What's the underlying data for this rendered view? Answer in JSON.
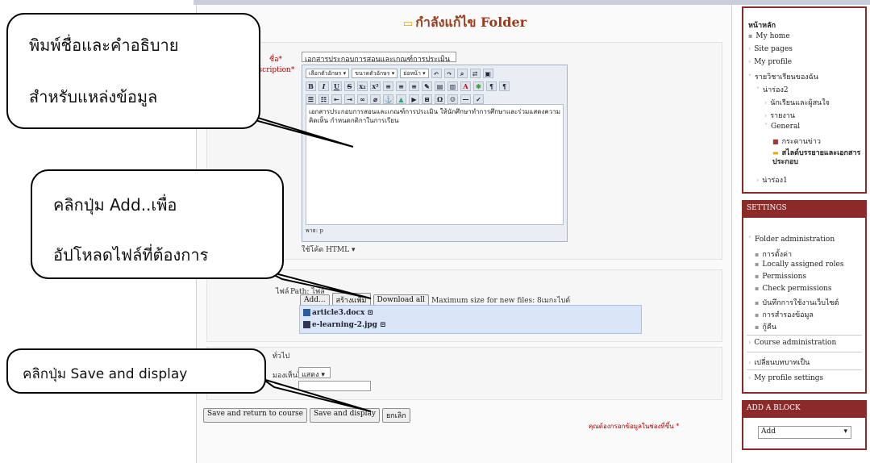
{
  "page": {
    "heading": "กำลังแก้ไข Folder"
  },
  "form": {
    "name_label": "ชื่อ",
    "name_value": "เอกสารประกอบการสอนและเกณฑ์การประเมิน",
    "description_label": "Description",
    "required_mark": "*",
    "editor": {
      "font_select": "เลือกตัวอักษร",
      "size_select": "ขนาดตัวอักษร",
      "style_select": "ย่อหน้า",
      "content": "เอกสารประกอบการสอนและเกณฑ์การประเมิน ให้นักศึกษาทำการศึกษาและร่วมแสดงความคิดเห็น กำหนดกติกาในการเรียน",
      "path": "พาธ: p",
      "format_select": "ใช้โค้ด HTML"
    },
    "files_label": "ไฟล์",
    "path_label": "Path:",
    "path_value": "ไฟล์",
    "add_button": "Add...",
    "create_folder_button": "สร้างแฟ้ม",
    "download_all_button": "Download all",
    "max_size": "Maximum size for new files: 8เมกะไบต์",
    "files": [
      {
        "name": "article3.docx"
      },
      {
        "name": "e-learning-2.jpg"
      }
    ],
    "section_header": "ทั่วไป",
    "visible_label": "มองเห็นได้",
    "visible_value": "แสดง",
    "save_return_button": "Save and return to course",
    "save_display_button": "Save and display",
    "cancel_button": "ยกเลิก",
    "required_note": "คุณต้องกรอกข้อมูลในช่องที่ขึ้น *"
  },
  "sidebar": {
    "navigation": {
      "title": "หน้าหลัก",
      "items": [
        {
          "label": "My home"
        },
        {
          "label": "Site pages"
        },
        {
          "label": "My profile"
        },
        {
          "label": "รายวิชาเรียนของฉัน"
        },
        {
          "label": "น่าร่อง2"
        },
        {
          "label": "นักเรียนและผู้สนใจ"
        },
        {
          "label": "รายงาน"
        },
        {
          "label": "General"
        },
        {
          "label": "กระดานข่าว"
        },
        {
          "label": "สไลด์บรรยายและเอกสารประกอบ"
        },
        {
          "label": "น่าร่อง1"
        }
      ]
    },
    "settings": {
      "title": "SETTINGS",
      "folder_admin": "Folder administration",
      "items": [
        {
          "label": "การตั้งค่า"
        },
        {
          "label": "Locally assigned roles"
        },
        {
          "label": "Permissions"
        },
        {
          "label": "Check permissions"
        },
        {
          "label": "บันทึกการใช้งานเว็บไซต์"
        },
        {
          "label": "การสำรองข้อมูล"
        },
        {
          "label": "กู้คืน"
        }
      ],
      "course_admin": "Course administration",
      "switch_role": "เปลี่ยนบทบาทเป็น",
      "profile_settings": "My profile settings"
    },
    "add_block": {
      "title": "ADD A BLOCK",
      "select_value": "Add"
    }
  },
  "callouts": {
    "name_desc_line1": "พิมพ์ชื่อและคำอธิบาย",
    "name_desc_line2": "สำหรับแหล่งข้อมูล",
    "add_line1": "คลิกปุ่ม Add..เพื่อ",
    "add_line2": "อัปโหลดไฟล์ที่ต้องการ",
    "save_line": "คลิกปุ่ม Save and display"
  }
}
